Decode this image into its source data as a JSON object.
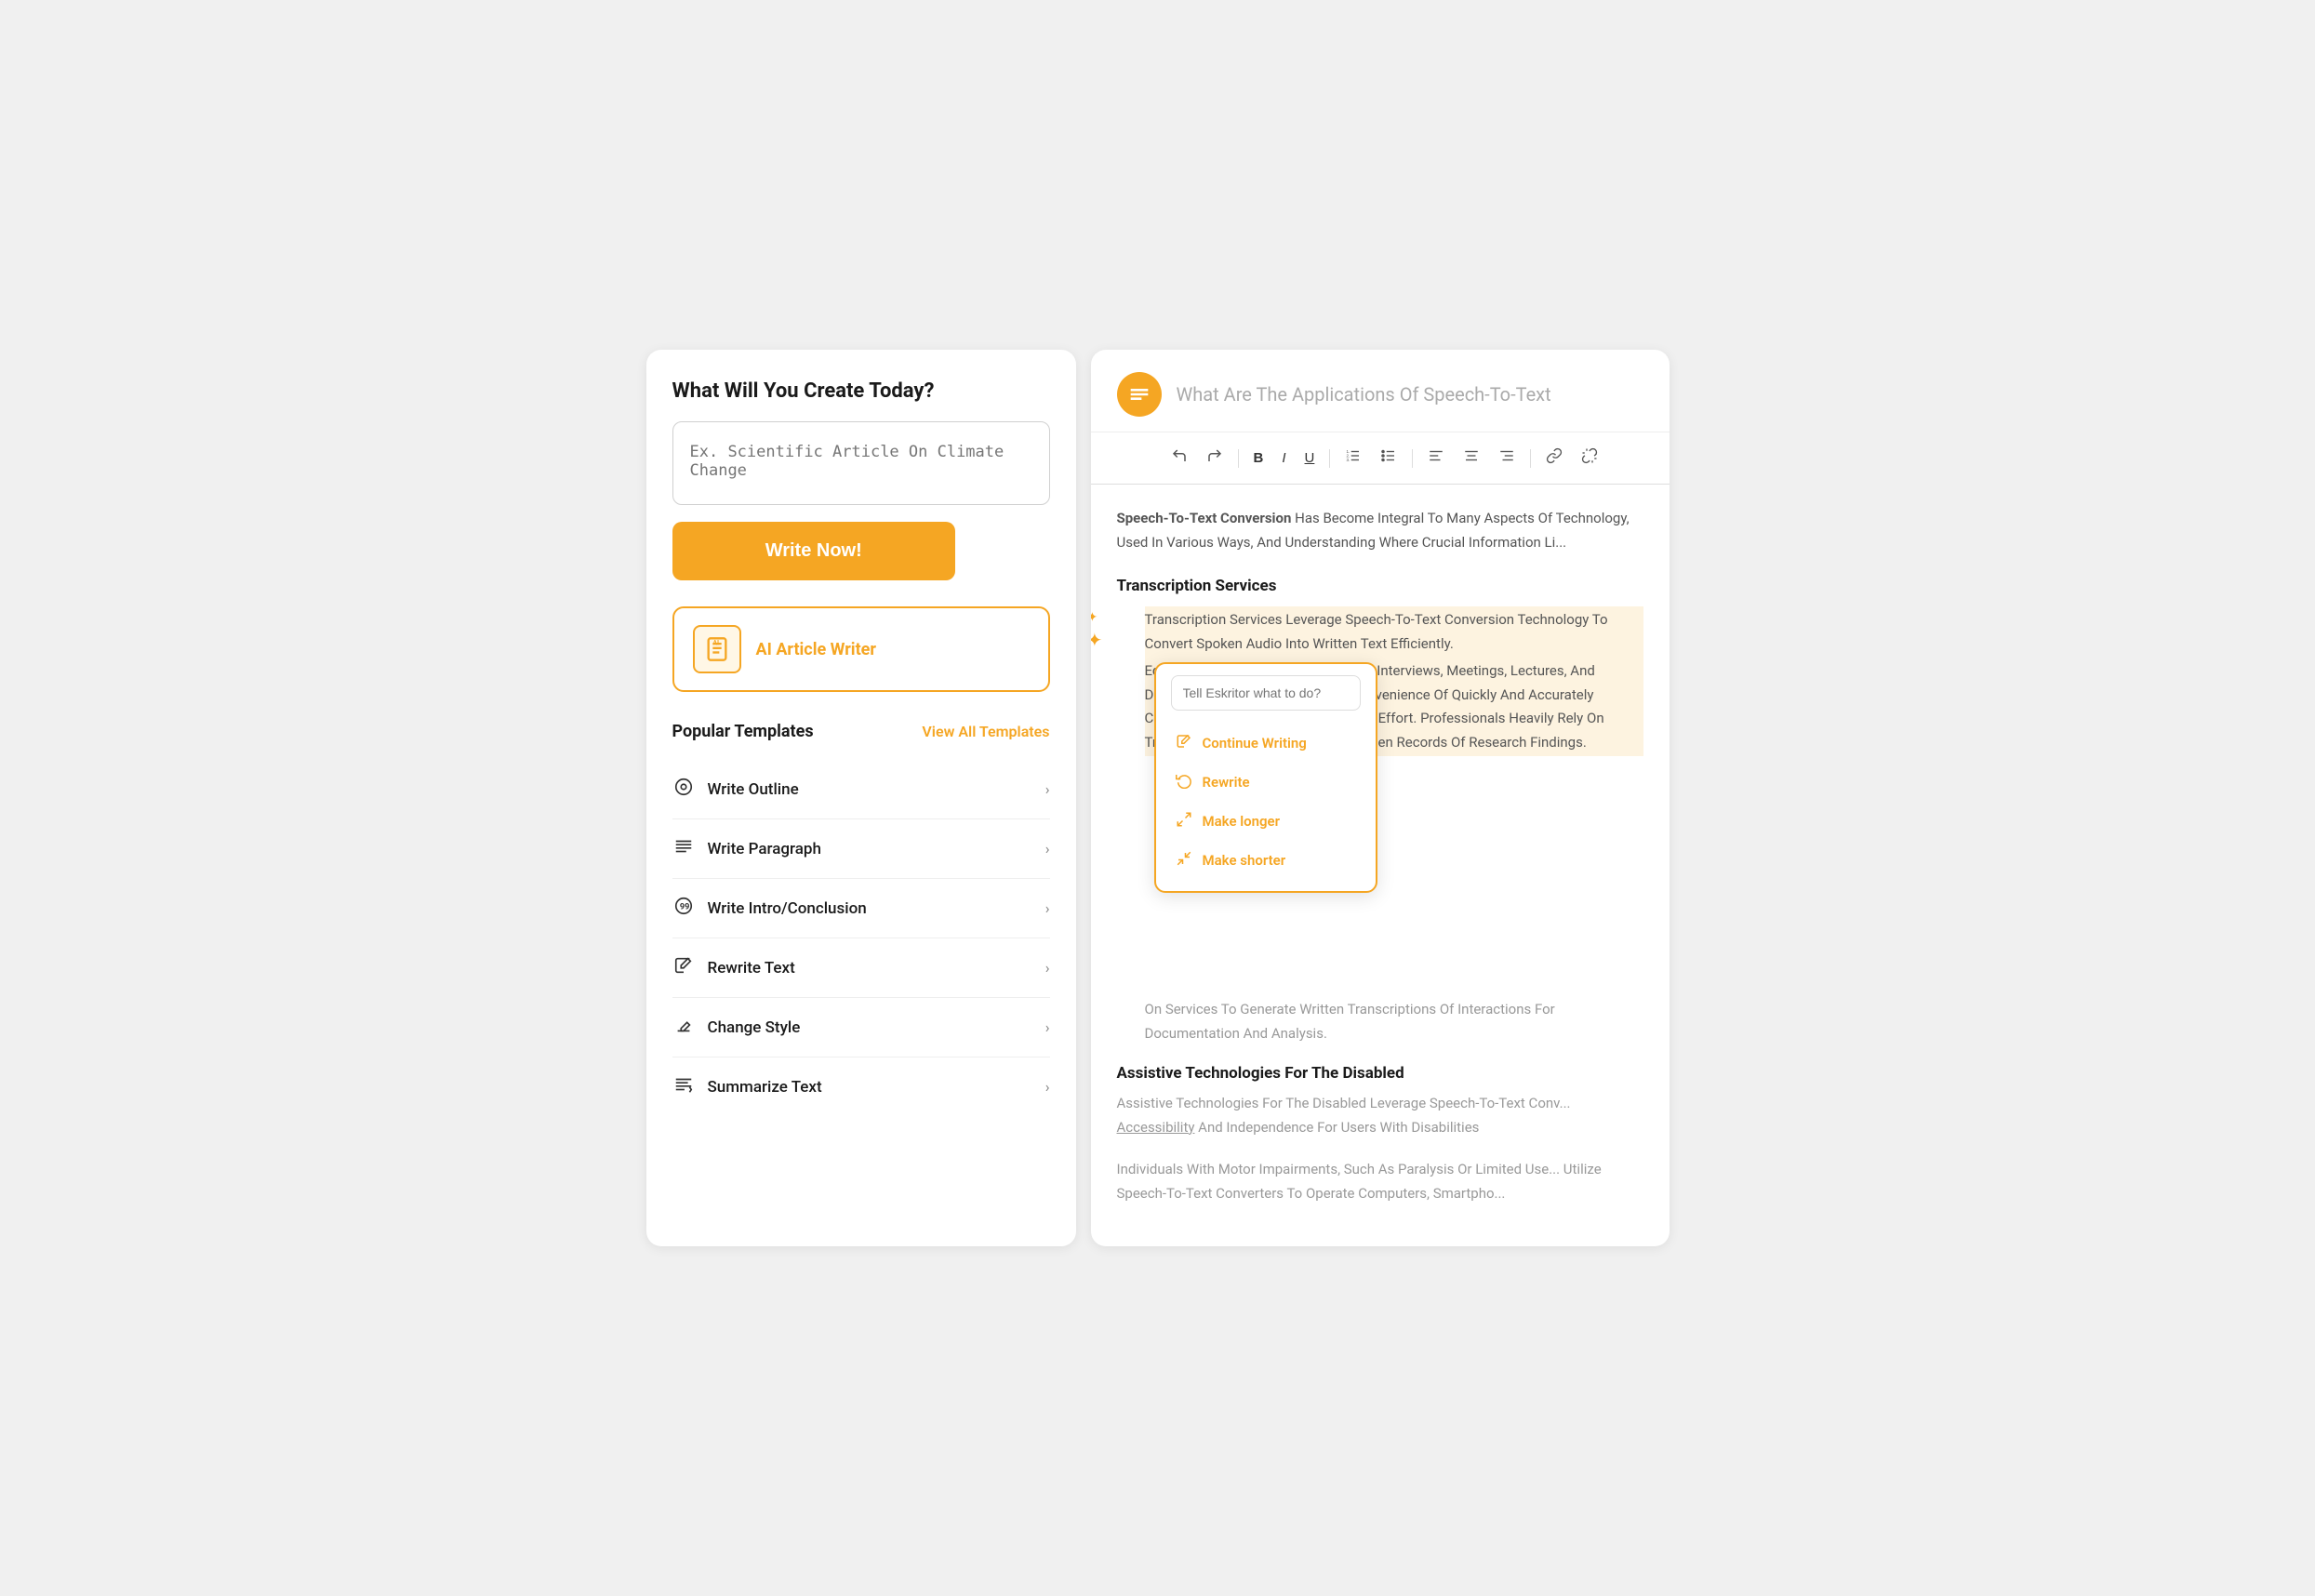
{
  "left_panel": {
    "title": "What Will You Create Today?",
    "search_placeholder": "Ex. Scientific Article On Climate Change",
    "write_button": "Write Now!",
    "ai_card": {
      "label": "AI Article Writer"
    },
    "popular_section": {
      "title": "Popular Templates",
      "view_all": "View All Templates",
      "templates": [
        {
          "name": "Write Outline",
          "icon": "⊙"
        },
        {
          "name": "Write Paragraph",
          "icon": "≡"
        },
        {
          "name": "Write Intro/Conclusion",
          "icon": "⑨"
        },
        {
          "name": "Rewrite Text",
          "icon": "✏"
        },
        {
          "name": "Change Style",
          "icon": "✒"
        },
        {
          "name": "Summarize Text",
          "icon": "≡"
        }
      ]
    }
  },
  "right_panel": {
    "title_part1": "What Are The Applications Of ",
    "title_part2": "Speech-To-Text",
    "content_intro": "Speech-To-Text Conversion Has Become Integral To Many Aspects Of Technology, Used In Various Ways, And Understanding Where Crucial Information Lies...",
    "section1_heading": "Transcription Services",
    "section1_highlight1": "Transcription Services Leverage Speech-To-Text Conversion Technology To Convert Spoken Audio Into Written Text Efficiently.",
    "section1_rest": "Editors Benefit From Transcription Of Interviews, Meetings, Lectures, And Dictations. Users Appreciate The Convenience Of Quickly And Accurately Converting Content, Saving Time And Effort. Professionals Heavily Rely On Transcription Services To Create Written Records Of Research Findings.",
    "section1_tail": "On Services To Generate Written Transcriptions Of Interactions For Documentation And Analysis.",
    "context_menu": {
      "input_placeholder": "Tell Eskritor what to do?",
      "items": [
        {
          "label": "Continue Writing",
          "icon": "✏"
        },
        {
          "label": "Rewrite",
          "icon": "↺"
        },
        {
          "label": "Make longer",
          "icon": "↔"
        },
        {
          "label": "Make shorter",
          "icon": "↔"
        }
      ]
    },
    "section2_heading": "Assistive Technologies For The Disabled",
    "section2_text": "Assistive Technologies For The Disabled Leverage Speech-To-Text Conv... Accessibility And Independence For Users With Disabilities",
    "section3_text": "Individuals With Motor Impairments, Such As Paralysis Or Limited Use... Utilize Speech-To-Text Converters To Operate Computers, Smartpho..."
  },
  "colors": {
    "orange": "#f5a623",
    "dark": "#1a1a1a",
    "muted": "#888888",
    "light_orange_bg": "#fdf3e0"
  }
}
